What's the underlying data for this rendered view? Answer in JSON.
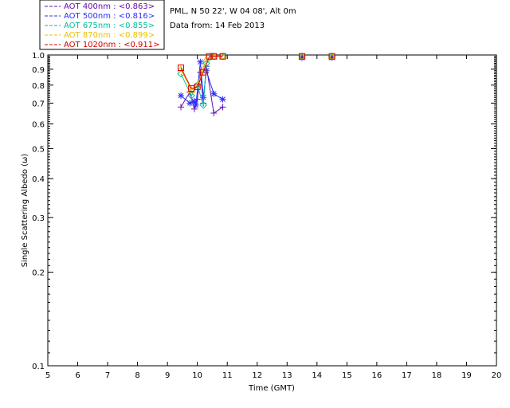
{
  "chart_data": {
    "type": "scatter",
    "title_lines": [
      "PML, N 50 22', W 04 08', Alt 0m",
      "Data from: 14 Feb 2013"
    ],
    "xlabel": "Time (GMT)",
    "ylabel": "Single Scattering Albedo (ω)",
    "xlim": [
      5,
      20
    ],
    "ylim": [
      0.1,
      1.0
    ],
    "yscale": "log",
    "xticks": [
      5,
      6,
      7,
      8,
      9,
      10,
      11,
      12,
      13,
      14,
      15,
      16,
      17,
      18,
      19,
      20
    ],
    "yticks": [
      {
        "value": 1.0,
        "label": "1.0"
      },
      {
        "value": 0.9,
        "label": "0.9"
      },
      {
        "value": 0.8,
        "label": "0.8"
      },
      {
        "value": 0.7,
        "label": "0.7"
      },
      {
        "value": 0.6,
        "label": "0.6"
      },
      {
        "value": 0.5,
        "label": "0.5"
      },
      {
        "value": 0.4,
        "label": "0.4"
      },
      {
        "value": 0.3,
        "label": "0.3"
      },
      {
        "value": 0.2,
        "label": "0.2"
      },
      {
        "value": 0.1,
        "label": "0.1"
      }
    ],
    "grid": false,
    "legend_position": "top-left",
    "series": [
      {
        "name": "AOT  400nm : <0.863>",
        "color": "#6a0dad",
        "marker": "plus",
        "x": [
          9.45,
          9.75,
          9.9,
          10.0,
          10.1,
          10.2,
          10.3,
          10.55,
          10.85,
          13.5,
          14.5
        ],
        "y": [
          0.68,
          0.76,
          0.67,
          0.72,
          0.88,
          0.7,
          0.92,
          0.65,
          0.68,
          0.99,
          0.99
        ]
      },
      {
        "name": "AOT  500nm : <0.816>",
        "color": "#2b2bff",
        "marker": "asterisk",
        "x": [
          9.45,
          9.75,
          9.9,
          9.95,
          10.1,
          10.2,
          10.3,
          10.55,
          10.85,
          13.5,
          14.5
        ],
        "y": [
          0.74,
          0.7,
          0.71,
          0.69,
          0.95,
          0.73,
          0.89,
          0.75,
          0.72,
          0.98,
          0.98
        ]
      },
      {
        "name": "AOT  675nm : <0.855>",
        "color": "#00c0a0",
        "marker": "diamond",
        "x": [
          9.45,
          9.8,
          10.0,
          10.2,
          10.3,
          10.55,
          10.85,
          13.5,
          14.5
        ],
        "y": [
          0.87,
          0.74,
          0.8,
          0.69,
          0.94,
          0.99,
          0.99,
          0.99,
          0.99
        ]
      },
      {
        "name": "AOT  870nm : <0.899>",
        "color": "#e8c000",
        "marker": "triangle",
        "x": [
          9.45,
          9.8,
          10.0,
          10.2,
          10.3,
          10.55,
          10.85,
          13.5,
          14.5
        ],
        "y": [
          0.9,
          0.77,
          0.8,
          0.9,
          0.97,
          0.99,
          0.99,
          0.99,
          0.99
        ]
      },
      {
        "name": "AOT 1020nm : <0.911>",
        "color": "#d40000",
        "marker": "square",
        "x": [
          9.45,
          9.8,
          10.0,
          10.2,
          10.4,
          10.55,
          10.85,
          13.5,
          14.5
        ],
        "y": [
          0.91,
          0.78,
          0.79,
          0.88,
          0.99,
          0.99,
          0.99,
          0.99,
          0.99
        ]
      }
    ]
  }
}
